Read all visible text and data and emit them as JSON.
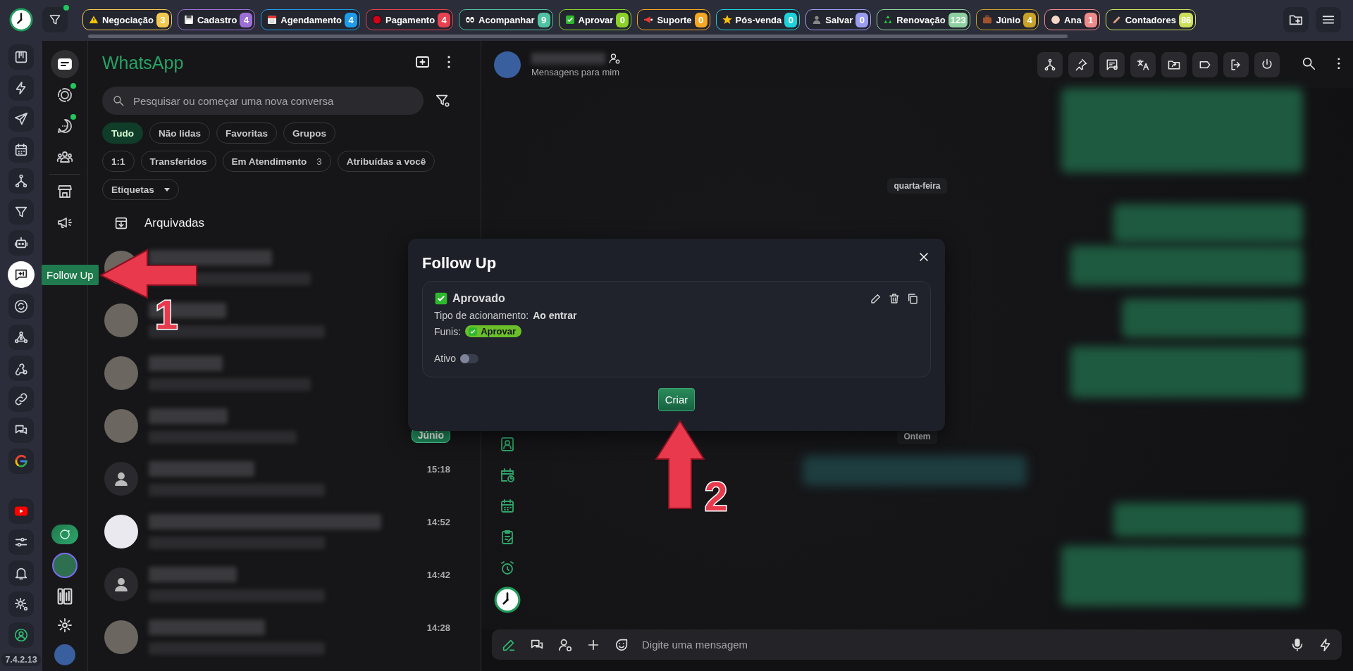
{
  "topbar": {
    "tabs": [
      {
        "label": "Negociação",
        "count": "3",
        "color": "#f2c94c"
      },
      {
        "label": "Cadastro",
        "count": "4",
        "color": "#9b6fd6"
      },
      {
        "label": "Agendamento",
        "count": "4",
        "color": "#1e9be9"
      },
      {
        "label": "Pagamento",
        "count": "4",
        "color": "#e8414f"
      },
      {
        "label": "Acompanhar",
        "count": "9",
        "color": "#4fc3a1"
      },
      {
        "label": "Aprovar",
        "count": "0",
        "color": "#8bd12a"
      },
      {
        "label": "Suporte",
        "count": "0",
        "color": "#f5a623"
      },
      {
        "label": "Pós-venda",
        "count": "0",
        "color": "#1fd1d8"
      },
      {
        "label": "Salvar",
        "count": "0",
        "color": "#9a9cf0"
      },
      {
        "label": "Renovação",
        "count": "123",
        "color": "#8fd0a0"
      },
      {
        "label": "Júnio",
        "count": "4",
        "color": "#c9a227"
      },
      {
        "label": "Ana",
        "count": "1",
        "color": "#f08a8a"
      },
      {
        "label": "Contadores",
        "count": "86",
        "color": "#cde05a"
      }
    ]
  },
  "rail": {
    "top": [
      {
        "selected": false
      },
      {
        "selected": false
      },
      {
        "selected": false
      },
      {
        "selected": false
      },
      {
        "selected": false
      },
      {
        "selected": false
      },
      {
        "selected": false
      },
      {
        "selected": true
      },
      {
        "selected": false
      },
      {
        "selected": false
      },
      {
        "selected": false
      },
      {
        "selected": false
      },
      {
        "selected": false
      },
      {
        "selected": false
      }
    ],
    "bottom": [
      {
        "selected": false
      },
      {
        "selected": false
      },
      {
        "selected": false
      },
      {
        "selected": false
      },
      {
        "selected": false
      }
    ],
    "version": "7.4.2.13",
    "tooltip": "Follow Up"
  },
  "nav": {
    "items": [
      {
        "selected": true,
        "unread": false
      },
      {
        "selected": false,
        "unread": true
      },
      {
        "selected": false,
        "unread": true
      },
      {
        "selected": false,
        "unread": false
      },
      {
        "selected": false,
        "unread": false
      },
      {
        "selected": false,
        "unread": false
      }
    ]
  },
  "chat_list": {
    "title": "WhatsApp",
    "search": {
      "placeholder": "Pesquisar ou começar uma nova conversa"
    },
    "filter_rows": [
      [
        {
          "label": "Tudo",
          "selected": true
        },
        {
          "label": "Não lidas",
          "selected": false
        },
        {
          "label": "Favoritas",
          "selected": false
        },
        {
          "label": "Grupos",
          "selected": false
        }
      ],
      [
        {
          "label": "1:1",
          "selected": false
        },
        {
          "label": "Transferidos",
          "selected": false
        },
        {
          "label": "Em Atendimento",
          "count": "3",
          "selected": false
        },
        {
          "label": "Atribuídas a você",
          "selected": false
        }
      ]
    ],
    "labels_filter": "Etiquetas",
    "archived": "Arquivadas",
    "chats": [
      {
        "kind": "photo"
      },
      {
        "kind": "photo"
      },
      {
        "kind": "photo"
      },
      {
        "kind": "photo",
        "tag": {
          "label": "Júnio",
          "color": "#1f8a5a"
        }
      },
      {
        "kind": "default",
        "time": "15:18"
      },
      {
        "kind": "logo",
        "time": "14:52"
      },
      {
        "kind": "default",
        "time": "14:42"
      },
      {
        "kind": "photo",
        "time": "14:28"
      }
    ]
  },
  "chat": {
    "subtitle": "Mensagens para mim",
    "date_chips": [
      "quarta-feira",
      "Ontem"
    ],
    "composer": {
      "placeholder": "Digite uma mensagem"
    }
  },
  "modal": {
    "title": "Follow Up",
    "rules": [
      {
        "name": "Aprovado",
        "trigger_label": "Tipo de acionamento:",
        "trigger": "Ao entrar",
        "funnels_label": "Funis:",
        "funnels": [
          "Aprovar"
        ],
        "active_label": "Ativo",
        "active": false
      }
    ],
    "create_button": "Criar"
  },
  "annotations": [
    {
      "label": "1"
    },
    {
      "label": "2"
    }
  ]
}
